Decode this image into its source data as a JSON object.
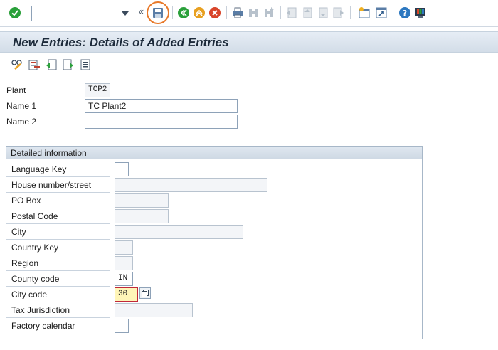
{
  "toolbar": {
    "command_field_value": "",
    "icons": [
      "enter-icon",
      "command-dropdown-icon",
      "save-icon",
      "back-icon",
      "exit-icon",
      "cancel-icon",
      "print-icon",
      "find-icon",
      "find-next-icon",
      "first-page-icon",
      "previous-page-icon",
      "next-page-icon",
      "last-page-icon",
      "create-session-icon",
      "shortcut-icon",
      "help-icon",
      "customize-layout-icon"
    ],
    "colors": {
      "enter": "#2aa03a",
      "save_highlight": "#e8792a",
      "back": "#2aa03a",
      "exit": "#e8a020",
      "cancel": "#d8452a",
      "help": "#2d78c0"
    }
  },
  "title": "New Entries: Details of Added Entries",
  "app_toolbar": {
    "icons": [
      "display-change-icon",
      "delete-icon",
      "previous-entry-icon",
      "next-entry-icon",
      "select-all-icon"
    ]
  },
  "header_fields": {
    "plant": {
      "label": "Plant",
      "value": "TCP2"
    },
    "name1": {
      "label": "Name 1",
      "value": "TC Plant2"
    },
    "name2": {
      "label": "Name 2",
      "value": ""
    }
  },
  "detailed_info": {
    "title": "Detailed information",
    "fields": [
      {
        "label": "Language Key",
        "value": ""
      },
      {
        "label": "House number/street",
        "value": ""
      },
      {
        "label": "PO Box",
        "value": ""
      },
      {
        "label": "Postal Code",
        "value": ""
      },
      {
        "label": "City",
        "value": ""
      },
      {
        "label": "Country Key",
        "value": ""
      },
      {
        "label": "Region",
        "value": ""
      },
      {
        "label": "County code",
        "value": "IN"
      },
      {
        "label": "City code",
        "value": "30"
      },
      {
        "label": "Tax Jurisdiction",
        "value": ""
      },
      {
        "label": "Factory calendar",
        "value": ""
      }
    ]
  }
}
